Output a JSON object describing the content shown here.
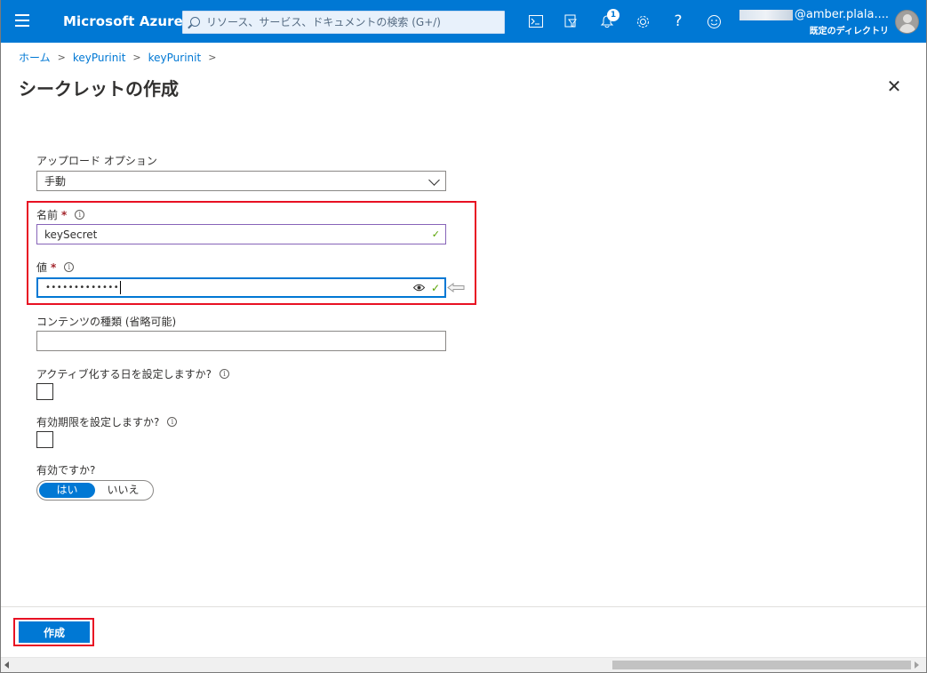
{
  "topbar": {
    "brand": "Microsoft Azure",
    "search_placeholder": "リソース、サービス、ドキュメントの検索 (G+/)",
    "notification_count": "1",
    "account_name": "@amber.plala....",
    "directory": "既定のディレクトリ",
    "icons": [
      "menu-icon",
      "cloud-shell-icon",
      "directory-filter-icon",
      "bell-icon",
      "gear-icon",
      "help-icon",
      "feedback-icon"
    ]
  },
  "breadcrumb": [
    "ホーム",
    "keyPurinit",
    "keyPurinit"
  ],
  "page_title": "シークレットの作成",
  "form": {
    "upload_label": "アップロード オプション",
    "upload_value": "手動",
    "name_label": "名前",
    "name_value": "keySecret",
    "value_label": "値",
    "value_masked": "•••••••••••••",
    "content_type_label": "コンテンツの種類 (省略可能)",
    "content_type_value": "",
    "activation_label": "アクティブ化する日を設定しますか?",
    "expiration_label": "有効期限を設定しますか?",
    "enabled_label": "有効ですか?",
    "enabled_yes": "はい",
    "enabled_no": "いいえ",
    "required_mark": "*",
    "info_glyph": "i"
  },
  "footer": {
    "create_label": "作成"
  },
  "colors": {
    "accent": "#0078d4",
    "highlight": "#e81123",
    "valid": "#57a300"
  }
}
